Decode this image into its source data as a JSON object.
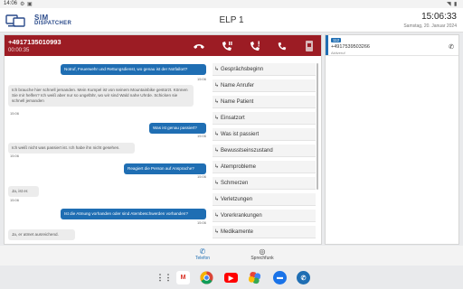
{
  "status_bar": {
    "time": "14:06"
  },
  "header": {
    "logo_line1": "SIM",
    "logo_line2": "DISPATCHER",
    "title": "ELP 1",
    "clock": "15:06:33",
    "date": "Samstag, 20. Januar 2024"
  },
  "call": {
    "number": "+4917135010993",
    "duration": "00:00:35",
    "buttons": [
      "hangup-icon",
      "hold-icon",
      "transfer-icon",
      "call-icon",
      "device-icon"
    ]
  },
  "chat": {
    "messages": [
      {
        "dir": "out",
        "text": "Notruf, Feuerwehr und Rettungsdienst, wo genau ist der Notfallort?",
        "time": "15:06"
      },
      {
        "dir": "in",
        "text": "Ich brauche hier schnell jemanden. Mein Kumpel ist von seinem Mountainbike gestürzt. Können Sie mir helfen? Ich weiß aber nur so ungefähr, wo wir sind Wald nahe Uhrde. Schicken sie schnell jemanden",
        "time": "15:06"
      },
      {
        "dir": "out",
        "text": "Was ist genau passiert?",
        "time": "15:06"
      },
      {
        "dir": "in",
        "text": "Ich weiß nicht was passiert ist. Ich habe ihn nicht gesehen.",
        "time": "15:06"
      },
      {
        "dir": "out",
        "text": "Reagiert die Person auf Ansprache?",
        "time": "15:06"
      },
      {
        "dir": "in",
        "text": "Ja, ist er.",
        "time": "15:06"
      },
      {
        "dir": "out",
        "text": "Ist die Atmung vorhanden oder sind Atembeschwerden vorhanden?",
        "time": "15:06"
      },
      {
        "dir": "in",
        "text": "Ja, er atmet ausreichend.",
        "time": ""
      }
    ]
  },
  "questions": {
    "items": [
      "Gesprächsbeginn",
      "Name Anrufer",
      "Name Patient",
      "Einsatzort",
      "Was ist passiert",
      "Bewusstseinszustand",
      "Atemprobleme",
      "Schmerzen",
      "Verletzungen",
      "Vorerkrankungen",
      "Medikamente"
    ],
    "arrow": "↳"
  },
  "queue": {
    "badge": "112",
    "number": "+4917539503266",
    "status": "Aktiveruf"
  },
  "nav": {
    "items": [
      {
        "label": "Telefon",
        "icon": "phone-icon",
        "active": true
      },
      {
        "label": "Sprechfunk",
        "icon": "radio-icon",
        "active": false
      }
    ]
  },
  "dock": {
    "apps": [
      "grid-icon",
      "gmail-icon",
      "chrome-icon",
      "youtube-icon",
      "photos-icon",
      "messages-icon",
      "dispatcher-icon"
    ]
  }
}
